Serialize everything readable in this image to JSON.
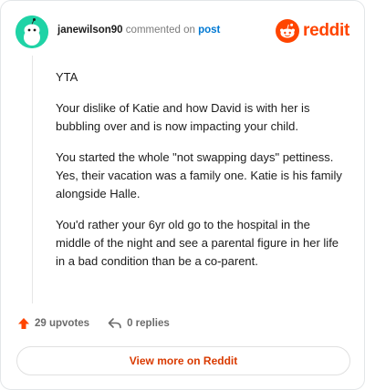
{
  "header": {
    "username": "janewilson90",
    "action_text": "commented on",
    "post_link": "post",
    "logo_text": "reddit"
  },
  "comment": {
    "paragraphs": [
      "YTA",
      "Your dislike of Katie and how David is with her is bubbling over and is now impacting your child.",
      "You started the whole \"not swapping days\" pettiness. Yes, their vacation was a family one. Katie is his family alongside Halle.",
      "You'd rather your 6yr old go to the hospital in the middle of the night and see a parental figure in her life in a bad condition than be a co-parent."
    ]
  },
  "actions": {
    "upvotes_label": "29 upvotes",
    "replies_label": "0 replies"
  },
  "view_more_label": "View more on Reddit",
  "colors": {
    "brand": "#ff4500",
    "link": "#0079d3",
    "avatar_bg": "#1fd3a6",
    "button_text": "#d93a00"
  },
  "icons": {
    "avatar": "snoo-avatar-icon",
    "logo": "reddit-logo-icon",
    "upvote": "upvote-arrow-icon",
    "reply": "reply-arrow-icon"
  }
}
